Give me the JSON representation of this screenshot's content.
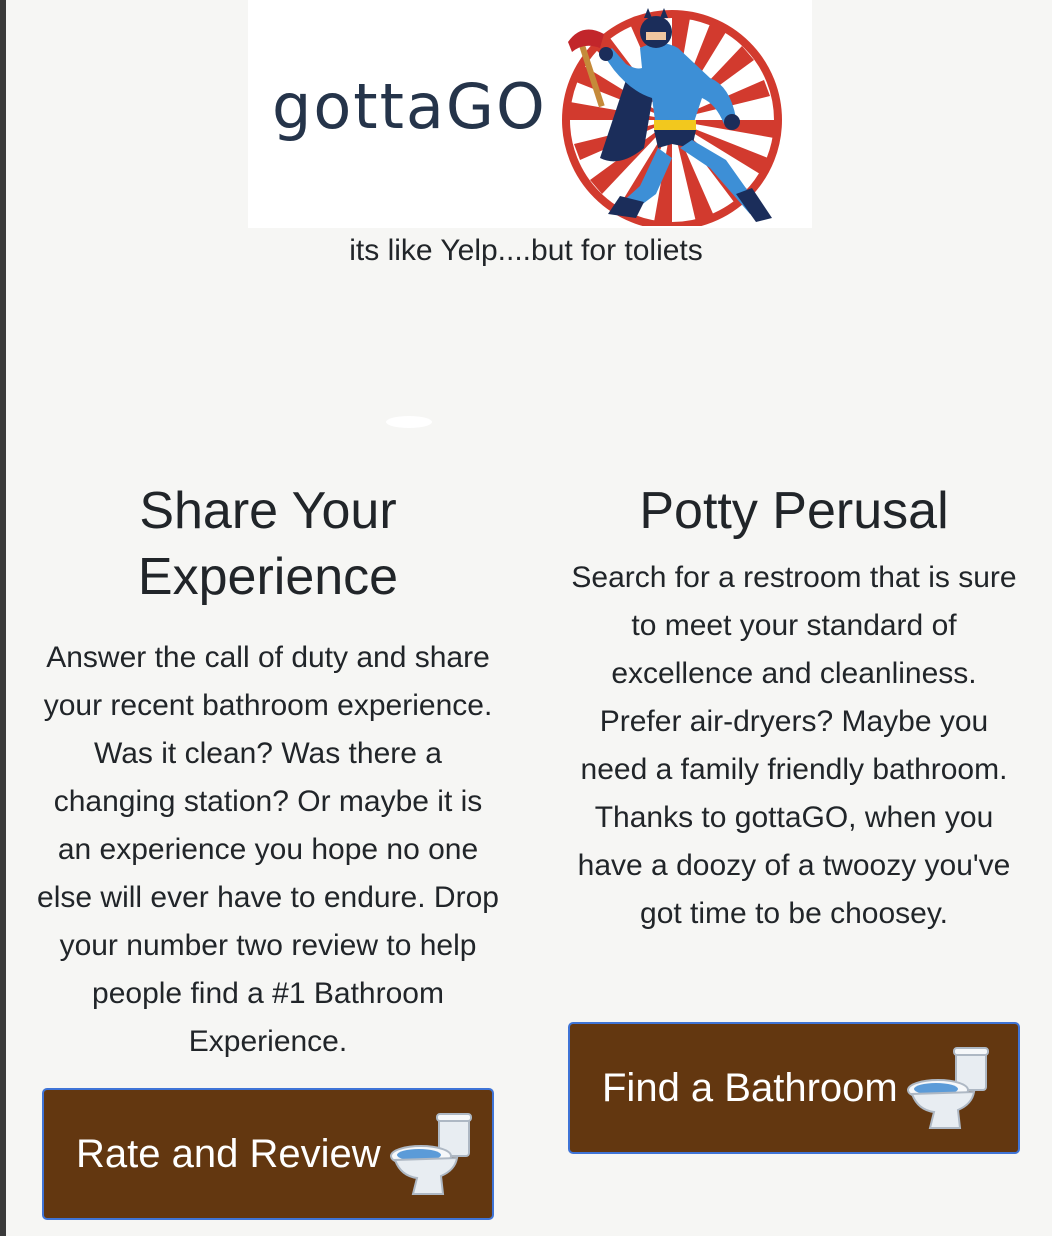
{
  "brand": {
    "name": "gottaGO",
    "tagline": "its like Yelp....but for toliets"
  },
  "sections": {
    "share": {
      "title": "Share Your Experience",
      "body": "Answer the call of duty and share your recent bathroom experience. Was it clean? Was there a changing station? Or maybe it is an experience you hope no one else will ever have to endure. Drop your number two review to help people find a #1 Bathroom Experience.",
      "button_label": "Rate and Review",
      "button_icon": "toilet-icon"
    },
    "perusal": {
      "title": "Potty Perusal",
      "body": "Search for a restroom that is sure to meet your standard of excellence and cleanliness. Prefer air-dryers? Maybe you need a family friendly bathroom. Thanks to gottaGO, when you have a doozy of a twoozy you've got time to be choosey.",
      "button_label": "Find a Bathroom",
      "button_icon": "toilet-icon"
    }
  },
  "colors": {
    "page_background": "#f6f6f4",
    "button_background": "#633710",
    "button_border": "#3f74d6",
    "logo_text": "#25344a",
    "mascot_blue": "#3d8fd6",
    "mascot_red": "#d23a2e"
  }
}
